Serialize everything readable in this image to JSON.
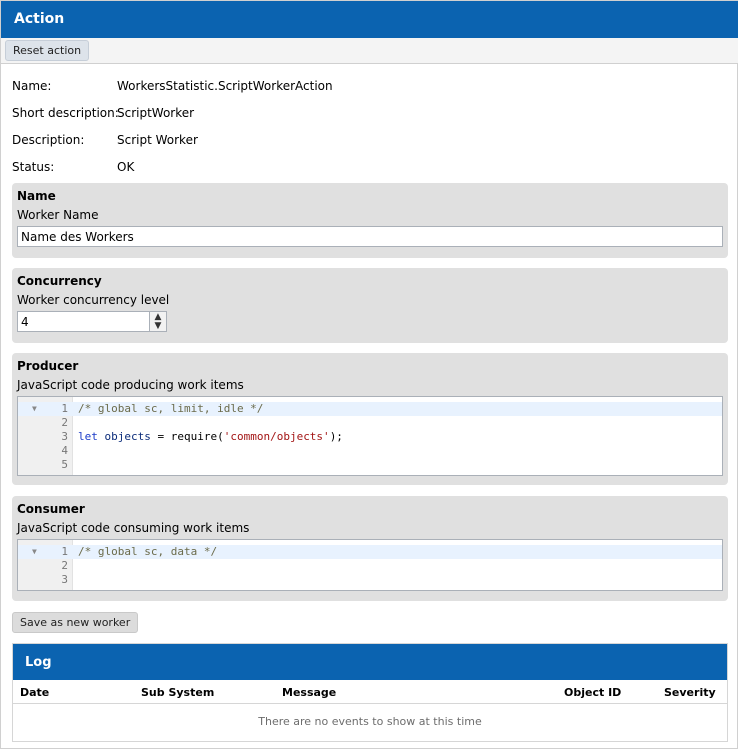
{
  "window": {
    "title": "Action"
  },
  "toolbar": {
    "reset_label": "Reset action"
  },
  "info": [
    {
      "label": "Name:",
      "value": "WorkersStatistic.ScriptWorkerAction"
    },
    {
      "label": "Short description:",
      "value": "ScriptWorker"
    },
    {
      "label": "Description:",
      "value": "Script Worker"
    },
    {
      "label": "Status:",
      "value": "OK"
    }
  ],
  "name_section": {
    "heading": "Name",
    "description": "Worker Name",
    "value": "Name des Workers"
  },
  "concurrency_section": {
    "heading": "Concurrency",
    "description": "Worker concurrency level",
    "value": "4",
    "up_symbol": "▲",
    "down_symbol": "▼"
  },
  "producer_section": {
    "heading": "Producer",
    "description": "JavaScript code producing work items",
    "line_numbers": [
      "1",
      "2",
      "3",
      "4",
      "5"
    ],
    "lines": {
      "l1_comment": "/* global sc, limit, idle */",
      "l3_keyword": "let",
      "l3_variable": "objects",
      "l3_operator": " = require(",
      "l3_string": "'common/objects'",
      "l3_end": ");"
    },
    "fold_marker": "▼"
  },
  "consumer_section": {
    "heading": "Consumer",
    "description": "JavaScript code consuming work items",
    "line_numbers": [
      "1",
      "2",
      "3"
    ],
    "lines": {
      "l1_comment": "/* global sc, data */"
    },
    "fold_marker": "▼"
  },
  "save_label": "Save as new worker",
  "log": {
    "title": "Log",
    "columns": [
      "Date",
      "Sub System",
      "Message",
      "Object ID",
      "Severity"
    ],
    "empty_text": "There are no events to show at this time"
  },
  "colors": {
    "header_blue": "#0b63b0",
    "panel_gray": "#e0e0e0",
    "active_line": "#e8f2fe"
  }
}
